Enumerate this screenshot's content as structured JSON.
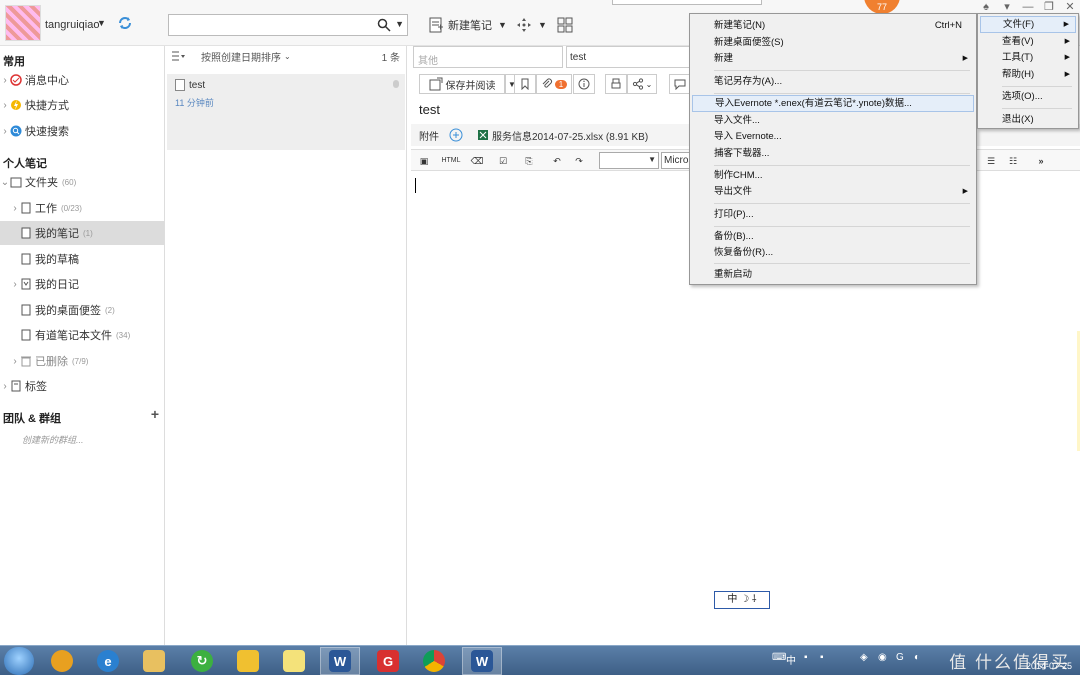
{
  "app": {
    "username": "tangruiqiao",
    "notification_count": "77"
  },
  "toolbar": {
    "new_note": "新建笔记"
  },
  "sidebar": {
    "common_title": "常用",
    "common_items": [
      {
        "label": "消息中心"
      },
      {
        "label": "快捷方式"
      },
      {
        "label": "快速搜索"
      }
    ],
    "personal_title": "个人笔记",
    "folders": {
      "label": "文件夹",
      "count": "(60)"
    },
    "folder_items": [
      {
        "label": "工作",
        "count": "(0/23)"
      },
      {
        "label": "我的笔记",
        "count": "(1)"
      },
      {
        "label": "我的草稿",
        "count": ""
      },
      {
        "label": "我的日记",
        "count": ""
      },
      {
        "label": "我的桌面便签",
        "count": "(2)"
      },
      {
        "label": "有道笔记本文件",
        "count": "(34)"
      },
      {
        "label": "已删除",
        "count": "(7/9)"
      }
    ],
    "tags": "标签",
    "team_title": "团队 & 群组",
    "create_group": "创建新的群组..."
  },
  "notelist": {
    "sort_label": "按照创建日期排序",
    "count": "1 条",
    "notes": [
      {
        "title": "test",
        "time": "11 分钟前"
      }
    ]
  },
  "editor": {
    "tag_placeholder": "其他",
    "title_value": "test",
    "save_read": "保存并阅读",
    "attachment_badge": "1",
    "heading": "test",
    "attachment_label": "附件",
    "attachment_file": "服务信息2014-07-25.xlsx (8.91 KB)",
    "html_label": "HTML",
    "font_name": "Micros",
    "more": "»"
  },
  "main_menu": {
    "items": [
      {
        "label": "文件(F)",
        "submenu": true
      },
      {
        "label": "查看(V)",
        "submenu": true
      },
      {
        "label": "工具(T)",
        "submenu": true
      },
      {
        "label": "帮助(H)",
        "submenu": true
      },
      {
        "label": "选项(O)...",
        "submenu": false
      },
      {
        "label": "退出(X)",
        "submenu": false
      }
    ]
  },
  "file_menu": {
    "items": [
      {
        "label": "新建笔记(N)",
        "shortcut": "Ctrl+N"
      },
      {
        "label": "新建桌面便签(S)",
        "shortcut": ""
      },
      {
        "label": "新建",
        "shortcut": ""
      },
      {
        "label": "笔记另存为(A)...",
        "shortcut": ""
      },
      {
        "label": "导入Evernote *.enex(有道云笔记*.ynote)数据...",
        "shortcut": ""
      },
      {
        "label": "导入文件...",
        "shortcut": ""
      },
      {
        "label": "导入 Evernote...",
        "shortcut": ""
      },
      {
        "label": "捕客下载器...",
        "shortcut": ""
      },
      {
        "label": "制作CHM...",
        "shortcut": ""
      },
      {
        "label": "导出文件",
        "shortcut": ""
      },
      {
        "label": "打印(P)...",
        "shortcut": ""
      },
      {
        "label": "备份(B)...",
        "shortcut": ""
      },
      {
        "label": "恢复备份(R)...",
        "shortcut": ""
      },
      {
        "label": "重新启动",
        "shortcut": ""
      }
    ]
  },
  "ime": {
    "label": "中 ☽ ⸸"
  },
  "taskbar": {
    "tray_lang": "中",
    "date": "2014-07-25",
    "watermark": "值 什么值得买"
  },
  "colors": {
    "accent": "#2d5aa8",
    "badge_orange": "#f08030",
    "selected_row": "#dcdcdc",
    "time_blue": "#5a88c0"
  }
}
